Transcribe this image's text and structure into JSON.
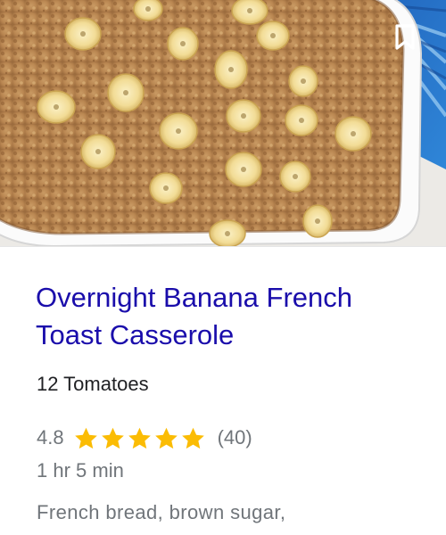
{
  "recipe": {
    "title": "Overnight Banana French Toast Casserole",
    "source": "12 Tomatoes",
    "rating": "4.8",
    "rating_value": 4.8,
    "stars_total": 5,
    "review_count": "(40)",
    "cook_time": "1 hr 5 min",
    "ingredients": "French bread, brown sugar,"
  },
  "icons": {
    "bookmark": "bookmark-icon",
    "star": "star-icon"
  },
  "colors": {
    "title_link": "#1a0dab",
    "star": "#fbbc04",
    "muted_text": "#70757a",
    "source_text": "#202124"
  }
}
